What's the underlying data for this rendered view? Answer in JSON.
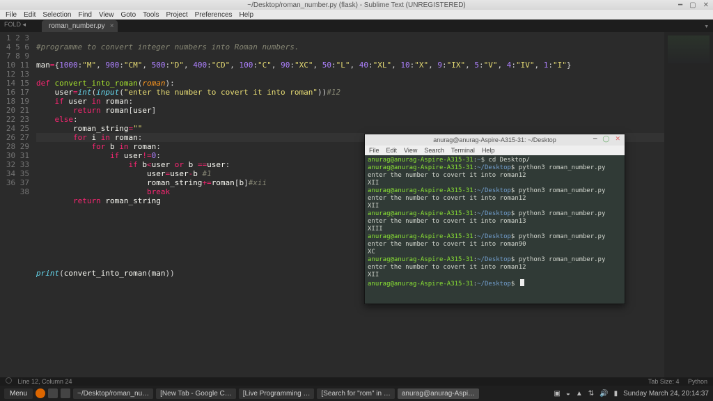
{
  "desktop": {
    "clock": "Sunday March 24, 20:14:37"
  },
  "sublime": {
    "title": "~/Desktop/roman_number.py (flask) - Sublime Text (UNREGISTERED)",
    "menus": [
      "File",
      "Edit",
      "Selection",
      "Find",
      "View",
      "Goto",
      "Tools",
      "Project",
      "Preferences",
      "Help"
    ],
    "side_label": "FOLD",
    "tab_name": "roman_number.py",
    "status_left": "Line 12, Column 24",
    "status_right_tab": "Tab Size: 4",
    "status_right_lang": "Python",
    "code_lines": 38,
    "highlighted_line": 12,
    "code": {
      "l2": "#programme to convert integer numbers into Roman numbers.",
      "l4_lhs": "man",
      "l4_dict_pairs": [
        [
          1000,
          "M"
        ],
        [
          900,
          "CM"
        ],
        [
          500,
          "D"
        ],
        [
          400,
          "CD"
        ],
        [
          100,
          "C"
        ],
        [
          90,
          "XC"
        ],
        [
          50,
          "L"
        ],
        [
          40,
          "XL"
        ],
        [
          10,
          "X"
        ],
        [
          9,
          "IX"
        ],
        [
          5,
          "V"
        ],
        [
          4,
          "IV"
        ],
        [
          1,
          "I"
        ]
      ],
      "l6_def": "def",
      "l6_fn": "convert_into_roman",
      "l6_arg": "roman",
      "l7_user": "user",
      "l7_int": "int",
      "l7_input": "input",
      "l7_prompt": "\"enter the number to covert it into roman\"",
      "l7_cmt": "#12",
      "l8": "if user in roman:",
      "l9": "return roman[user]",
      "l10": "else:",
      "l11_a": "roman_string",
      "l11_b": "\"\"",
      "l12": "for i in roman:",
      "l13": "for b in roman:",
      "l14": "if user!=0:",
      "l15": "if b<user or b ==user:",
      "l16": "user=user-b",
      "l16_cmt": "#1",
      "l17": "roman_string+=roman[b]",
      "l17_cmt": "#xii",
      "l18": "break",
      "l19": "return roman_string",
      "l27_print": "print",
      "l27_fn": "convert_into_roman",
      "l27_arg": "man"
    }
  },
  "terminal": {
    "title": "anurag@anurag-Aspire-A315-31: ~/Desktop",
    "menus": [
      "File",
      "Edit",
      "View",
      "Search",
      "Terminal",
      "Help"
    ],
    "user": "anurag@anurag-Aspire-A315-31",
    "home_path": "~",
    "desk_path": "~/Desktop",
    "lines": [
      {
        "path": "~",
        "cmd": "cd Desktop/"
      },
      {
        "path": "~/Desktop",
        "cmd": "python3 roman_number.py"
      },
      {
        "out": "enter the number to covert it into roman12"
      },
      {
        "out": "XII"
      },
      {
        "path": "~/Desktop",
        "cmd": "python3 roman_number.py"
      },
      {
        "out": "enter the number to covert it into roman12"
      },
      {
        "out": "XII"
      },
      {
        "path": "~/Desktop",
        "cmd": "python3 roman_number.py"
      },
      {
        "out": "enter the number to covert it into roman13"
      },
      {
        "out": "XIII"
      },
      {
        "path": "~/Desktop",
        "cmd": "python3 roman_number.py"
      },
      {
        "out": "enter the number to covert it into roman90"
      },
      {
        "out": "XC"
      },
      {
        "path": "~/Desktop",
        "cmd": "python3 roman_number.py"
      },
      {
        "out": "enter the number to covert it into roman12"
      },
      {
        "out": "XII"
      },
      {
        "path": "~/Desktop",
        "cmd": ""
      }
    ]
  },
  "taskbar": {
    "menu": "Menu",
    "items": [
      "~/Desktop/roman_nu…",
      "[New Tab - Google C…",
      "[Live Programming …",
      "[Search for \"rom\" in …",
      "anurag@anurag-Aspi…"
    ]
  }
}
